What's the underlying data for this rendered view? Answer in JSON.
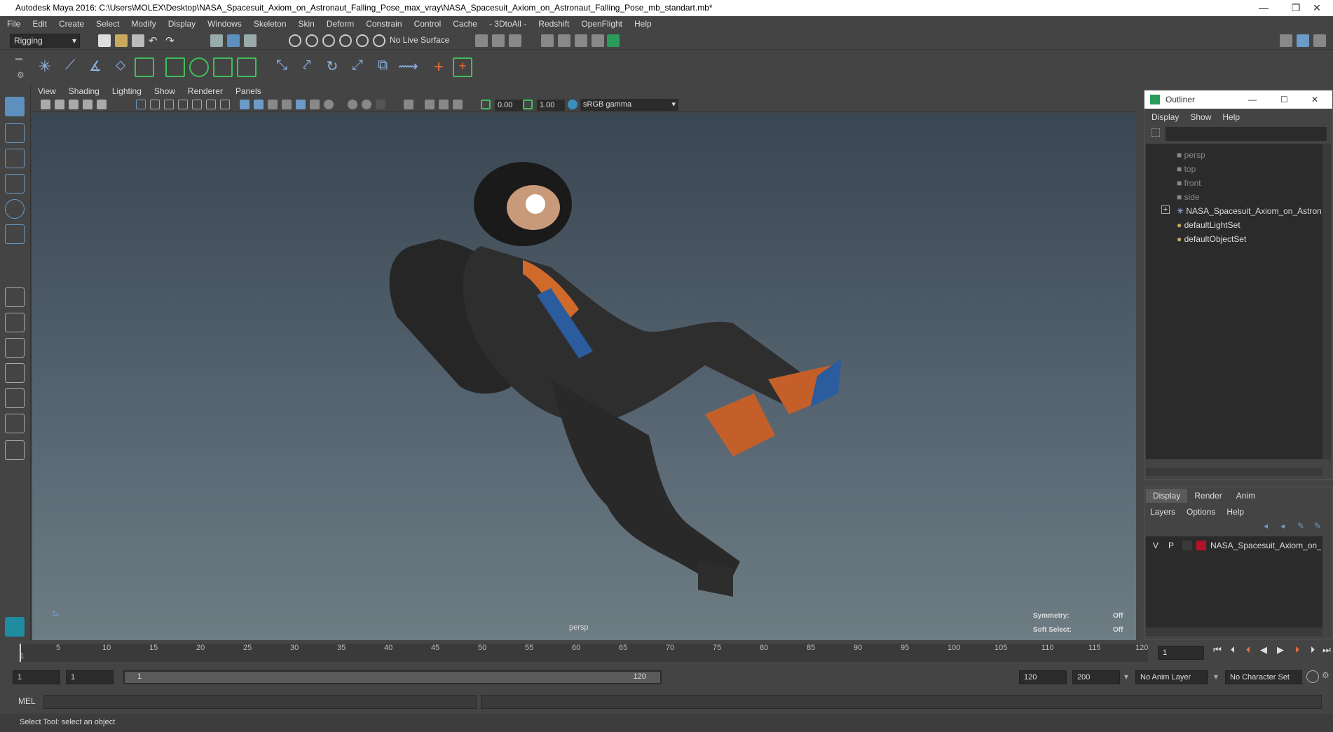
{
  "window": {
    "title": "Autodesk Maya 2016: C:\\Users\\MOLEX\\Desktop\\NASA_Spacesuit_Axiom_on_Astronaut_Falling_Pose_max_vray\\NASA_Spacesuit_Axiom_on_Astronaut_Falling_Pose_mb_standart.mb*",
    "minimize": "—",
    "restore": "❐",
    "close": "✕"
  },
  "menubar": [
    "File",
    "Edit",
    "Create",
    "Select",
    "Modify",
    "Display",
    "Windows",
    "Skeleton",
    "Skin",
    "Deform",
    "Constrain",
    "Control",
    "Cache",
    "- 3DtoAll -",
    "Redshift",
    "OpenFlight",
    "Help"
  ],
  "statusline": {
    "menuset": "Rigging",
    "live_surface": "No Live Surface"
  },
  "panel_menu": [
    "View",
    "Shading",
    "Lighting",
    "Show",
    "Renderer",
    "Panels"
  ],
  "panel_toolbar": {
    "exposure": "0.00",
    "gamma": "1.00",
    "color_space": "sRGB gamma"
  },
  "viewport": {
    "camera_label": "persp",
    "symmetry_label": "Symmetry:",
    "symmetry_value": "Off",
    "soft_select_label": "Soft Select:",
    "soft_select_value": "Off"
  },
  "outliner": {
    "title": "Outliner",
    "menu": [
      "Display",
      "Show",
      "Help"
    ],
    "items": [
      {
        "label": "persp",
        "icon": "camera-icon",
        "dim": true
      },
      {
        "label": "top",
        "icon": "camera-icon",
        "dim": true
      },
      {
        "label": "front",
        "icon": "camera-icon",
        "dim": true
      },
      {
        "label": "side",
        "icon": "camera-icon",
        "dim": true
      },
      {
        "label": "NASA_Spacesuit_Axiom_on_Astronaut",
        "icon": "joint-icon",
        "dim": false
      },
      {
        "label": "defaultLightSet",
        "icon": "set-icon",
        "dim": false
      },
      {
        "label": "defaultObjectSet",
        "icon": "set-icon",
        "dim": false
      }
    ]
  },
  "layers": {
    "tabs": [
      "Display",
      "Render",
      "Anim"
    ],
    "menu": [
      "Layers",
      "Options",
      "Help"
    ],
    "row": {
      "v": "V",
      "p": "P",
      "name": "NASA_Spacesuit_Axiom_on_Astron",
      "color": "#b3122a"
    }
  },
  "timeline": {
    "ticks": [
      "5",
      "10",
      "15",
      "20",
      "25",
      "30",
      "35",
      "40",
      "45",
      "50",
      "55",
      "60",
      "65",
      "70",
      "75",
      "80",
      "85",
      "90",
      "95",
      "100",
      "105",
      "110",
      "115",
      "120"
    ],
    "start_tick": "1",
    "current_frame": "1"
  },
  "range": {
    "start": "1",
    "playback_start": "1",
    "slider_start": "1",
    "slider_end": "120",
    "playback_end": "120",
    "end": "200",
    "anim_layer": "No Anim Layer",
    "char_set": "No Character Set"
  },
  "cmdline": {
    "label": "MEL"
  },
  "helpline": {
    "text": "Select Tool: select an object"
  }
}
